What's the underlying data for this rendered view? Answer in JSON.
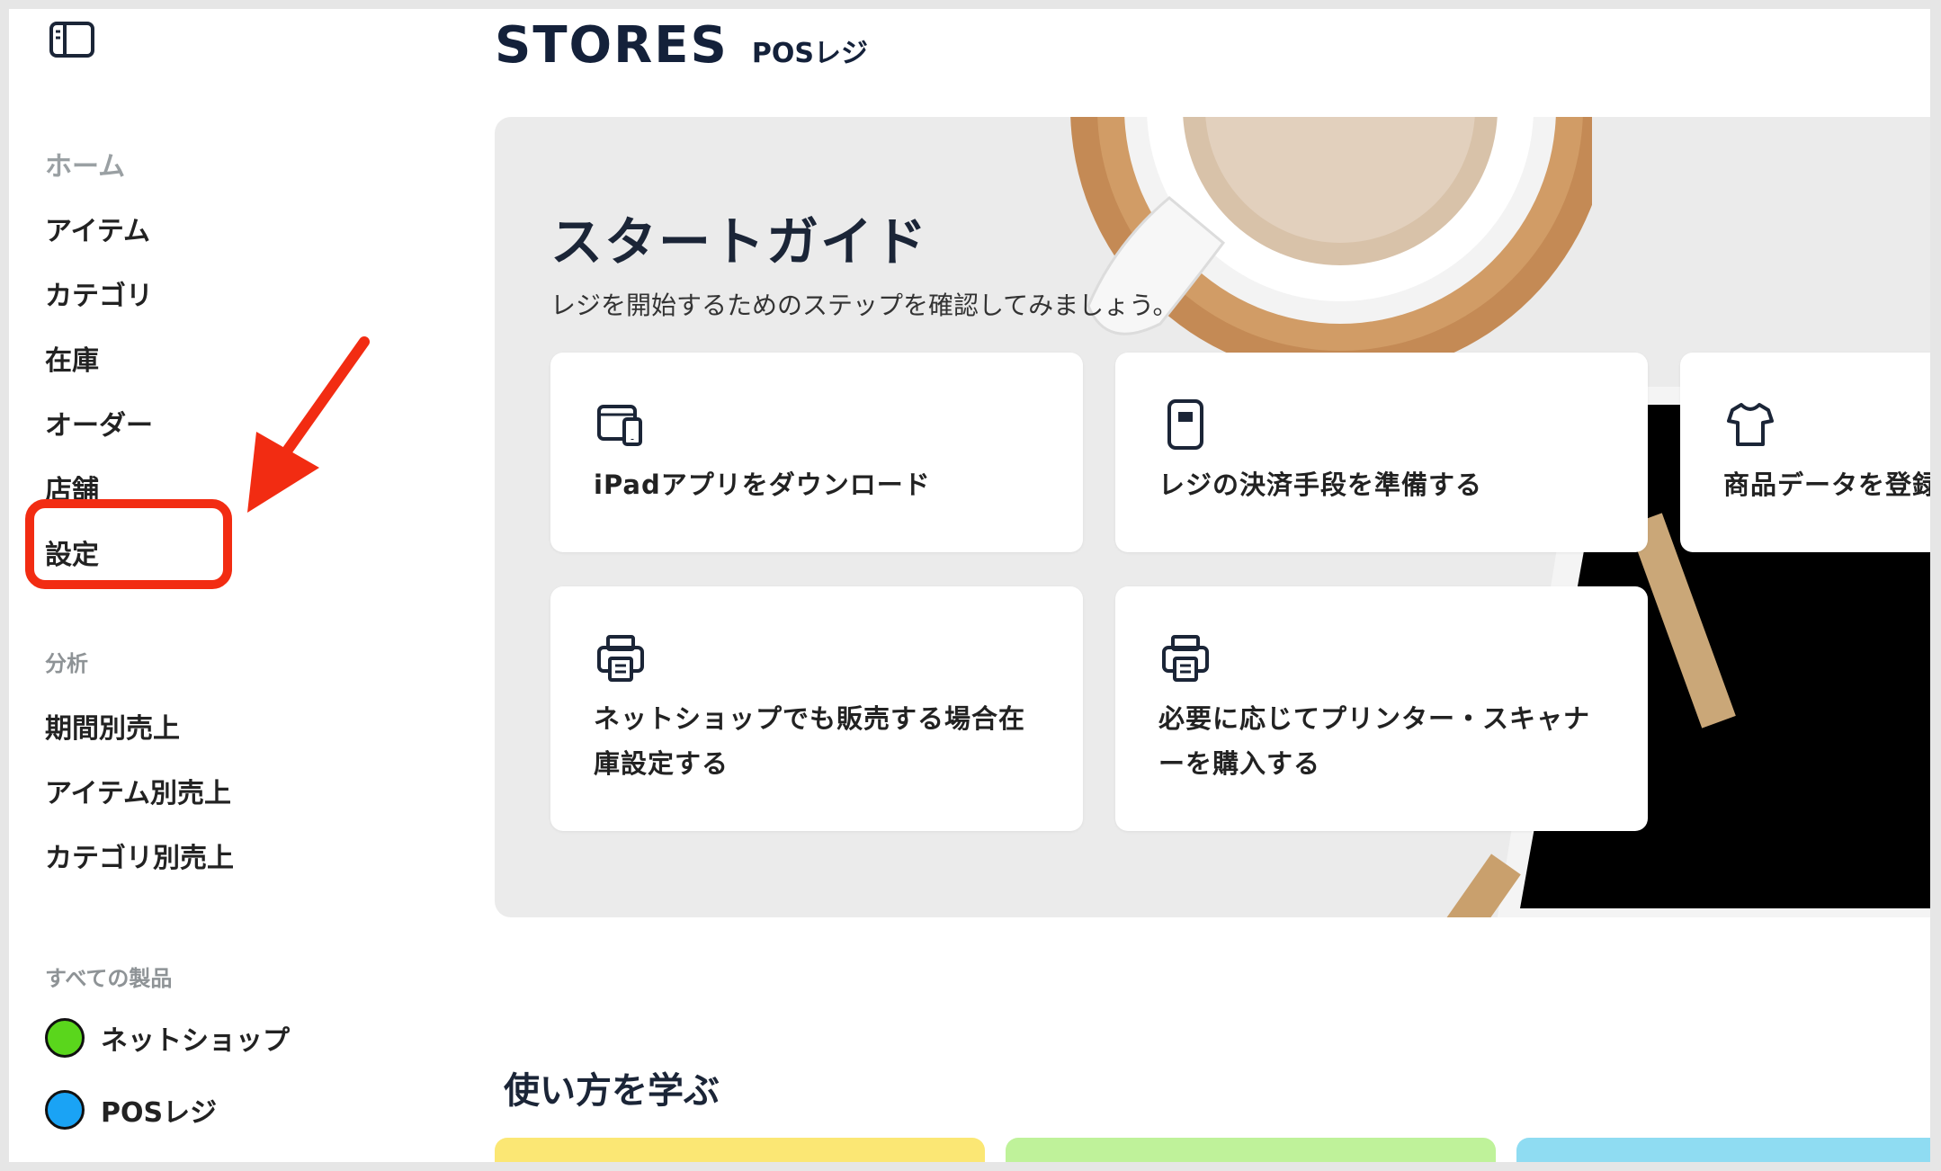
{
  "sidebar": {
    "items": [
      {
        "label": "ホーム"
      },
      {
        "label": "アイテム"
      },
      {
        "label": "カテゴリ"
      },
      {
        "label": "在庫"
      },
      {
        "label": "オーダー"
      },
      {
        "label": "店舗"
      },
      {
        "label": "設定"
      }
    ],
    "analysis_label": "分析",
    "analysis_items": [
      {
        "label": "期間別売上"
      },
      {
        "label": "アイテム別売上"
      },
      {
        "label": "カテゴリ別売上"
      }
    ],
    "products_label": "すべての製品",
    "products": [
      {
        "label": "ネットショップ",
        "color": "#5ad61c"
      },
      {
        "label": "POSレジ",
        "color": "#1aa3f5"
      }
    ]
  },
  "header": {
    "logo": "STORES",
    "product_name": "POSレジ"
  },
  "hero": {
    "title": "スタートガイド",
    "subtitle": "レジを開始するためのステップを確認してみましょう。",
    "cards": [
      {
        "label": "iPadアプリをダウンロード",
        "icon": "tablet-phone-icon"
      },
      {
        "label": "レジの決済手段を準備する",
        "icon": "card-reader-icon"
      },
      {
        "label": "商品データを登録",
        "icon": "tshirt-icon"
      },
      {
        "label_line1": "ネットショップでも販売する場合在",
        "label_line2": "庫設定する",
        "icon": "printer-icon"
      },
      {
        "label_line1": "必要に応じてプリンター・スキャナ",
        "label_line2": "ーを購入する",
        "icon": "printer-icon"
      }
    ]
  },
  "learn": {
    "title": "使い方を学ぶ",
    "card_colors": [
      "#fbe774",
      "#bff29a",
      "#8fdcf2"
    ]
  },
  "colors": {
    "accent_red": "#f22c12",
    "brand_navy": "#14213a"
  }
}
